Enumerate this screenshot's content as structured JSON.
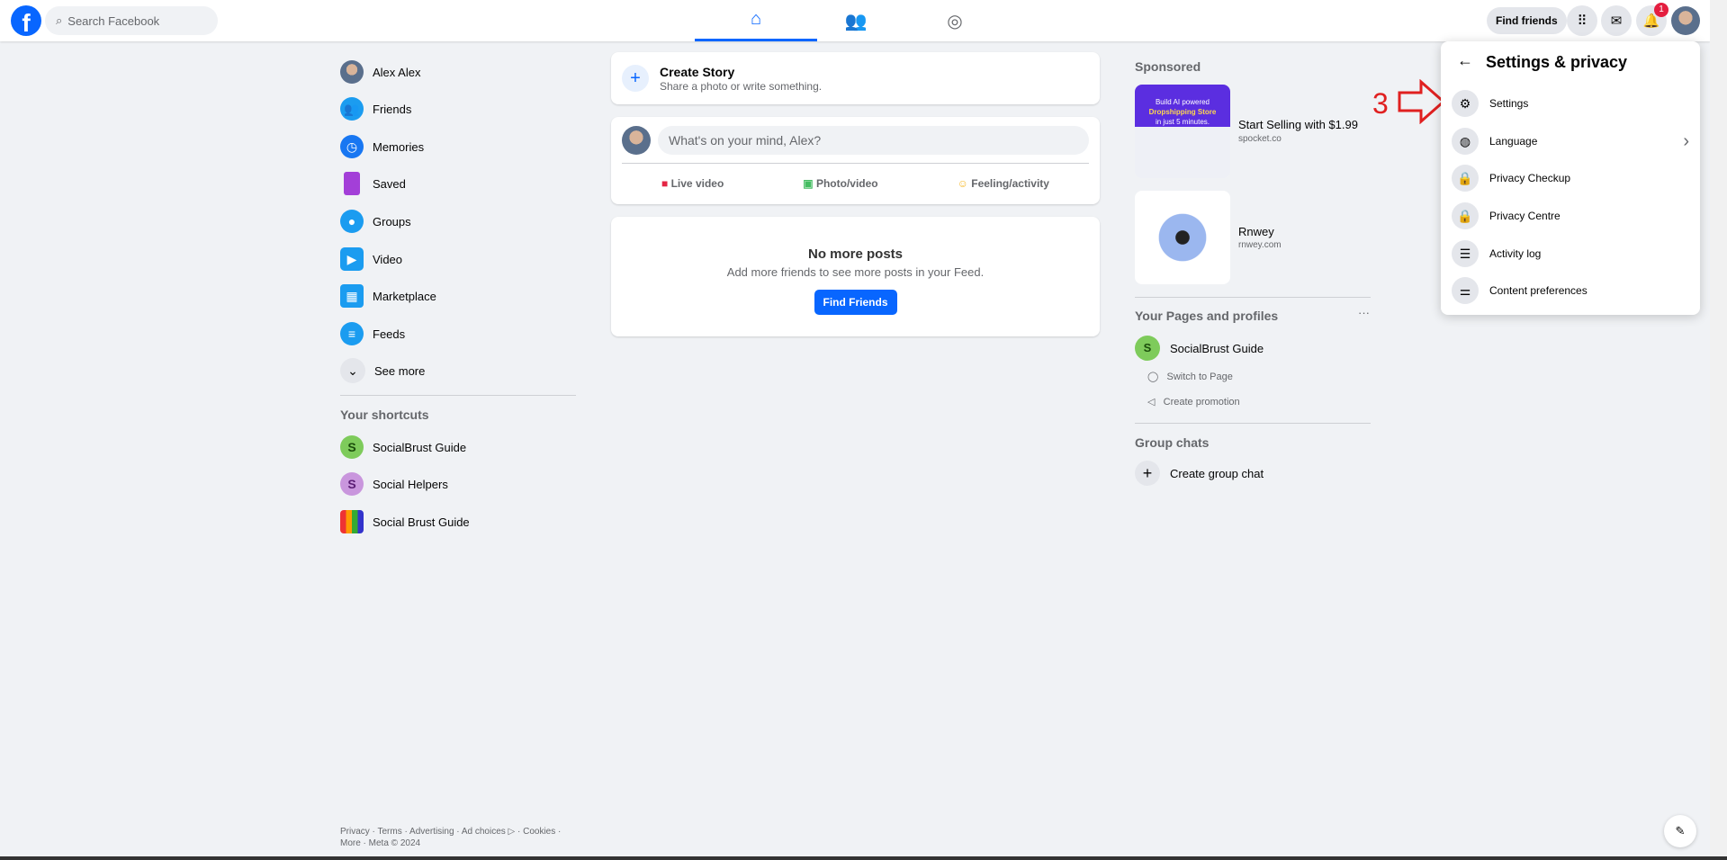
{
  "header": {
    "search_placeholder": "Search Facebook",
    "find_friends": "Find friends",
    "notification_count": "1",
    "logo": "f"
  },
  "sidebar": {
    "items": [
      {
        "label": "Alex Alex",
        "icon": "avatar"
      },
      {
        "label": "Friends",
        "icon": "friends-icon"
      },
      {
        "label": "Memories",
        "icon": "memories-icon"
      },
      {
        "label": "Saved",
        "icon": "saved-icon"
      },
      {
        "label": "Groups",
        "icon": "groups-icon"
      },
      {
        "label": "Video",
        "icon": "video-icon"
      },
      {
        "label": "Marketplace",
        "icon": "marketplace-icon"
      },
      {
        "label": "Feeds",
        "icon": "feeds-icon"
      },
      {
        "label": "See more",
        "icon": "chevron-down-icon"
      }
    ],
    "shortcuts_title": "Your shortcuts",
    "shortcuts": [
      {
        "label": "SocialBrust Guide",
        "initial": "S"
      },
      {
        "label": "Social Helpers",
        "initial": "S"
      },
      {
        "label": "Social Brust Guide"
      }
    ]
  },
  "feed": {
    "story_title": "Create Story",
    "story_sub": "Share a photo or write something.",
    "composer_placeholder": "What's on your mind, Alex?",
    "actions": [
      "Live video",
      "Photo/video",
      "Feeling/activity"
    ],
    "empty_title": "No more posts",
    "empty_sub": "Add more friends to see more posts in your Feed.",
    "find_friends_btn": "Find Friends"
  },
  "right": {
    "sponsored": "Sponsored",
    "ads": [
      {
        "title": "Start Selling with $1.99",
        "domain": "spocket.co",
        "image_text": [
          "Build AI powered",
          "Dropshipping Store",
          "in just 5 minutes."
        ]
      },
      {
        "title": "Rnwey",
        "domain": "rnwey.com"
      }
    ],
    "pages_title": "Your Pages and profiles",
    "page_name": "SocialBrust Guide",
    "page_initial": "S",
    "switch": "Switch to Page",
    "promo": "Create promotion",
    "group_title": "Group chats",
    "create_group": "Create group chat"
  },
  "menu": {
    "title": "Settings & privacy",
    "items": [
      "Settings",
      "Language",
      "Privacy Checkup",
      "Privacy Centre",
      "Activity log",
      "Content preferences"
    ]
  },
  "annotation": {
    "step": "3",
    "color": "#e02020"
  },
  "footer": {
    "line1": "Privacy · Terms · Advertising · Ad choices ▷ · Cookies ·",
    "line2": "More · Meta © 2024"
  },
  "colors": {
    "brand": "#0866ff",
    "background": "#f0f2f5"
  }
}
